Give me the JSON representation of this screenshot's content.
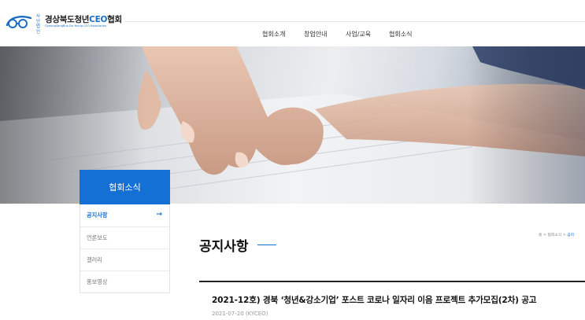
{
  "header": {
    "logo": {
      "prefix_line1": "사단",
      "prefix_line2": "법인",
      "name_main": "경상북도청년",
      "name_accent": "CEO",
      "name_tail": "협회",
      "subtitle": "GyeongSangBuk-Do Young CEO Association"
    },
    "nav": [
      {
        "label": "협회소개"
      },
      {
        "label": "창업안내"
      },
      {
        "label": "사업/교육"
      },
      {
        "label": "협회소식"
      }
    ]
  },
  "sidebar": {
    "title": "협회소식",
    "items": [
      {
        "label": "공지사항",
        "active": true,
        "arrow": "→"
      },
      {
        "label": "언론보도",
        "active": false
      },
      {
        "label": "갤러리",
        "active": false
      },
      {
        "label": "홍보영상",
        "active": false
      }
    ]
  },
  "main": {
    "page_title": "공지사항",
    "breadcrumb": {
      "home": "홈",
      "sep": ">",
      "section": "협회소식",
      "current": "공지"
    },
    "post": {
      "title": "2021-12호) 경북 ‘청년&강소기업’ 포스트 코로나 일자리 이음 프로젝트 추가모집(2차) 공고",
      "meta": "2021-07-20 (KYCEO)"
    }
  },
  "colors": {
    "accent": "#1570d6",
    "text_dark": "#111111",
    "muted": "#999999"
  }
}
